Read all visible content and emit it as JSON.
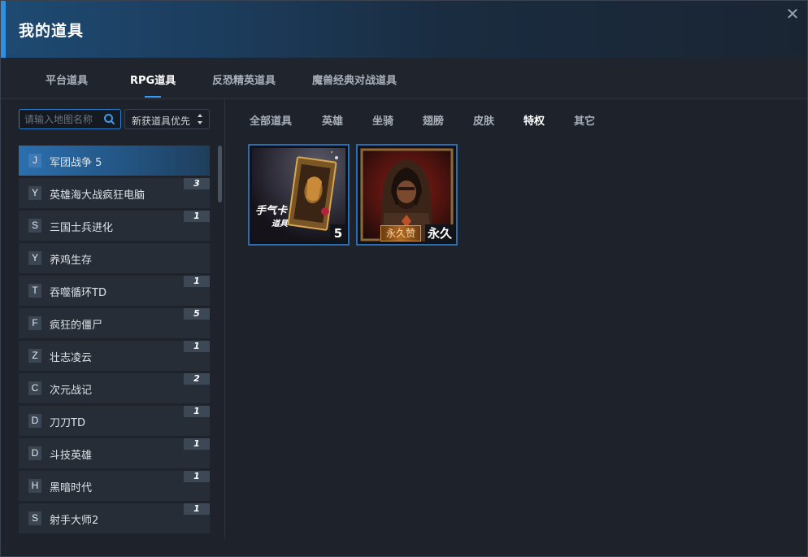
{
  "window": {
    "title": "我的道具",
    "close_glyph": "✕"
  },
  "main_tabs": [
    {
      "label": "平台道具",
      "active": false
    },
    {
      "label": "RPG道具",
      "active": true
    },
    {
      "label": "反恐精英道具",
      "active": false
    },
    {
      "label": "魔兽经典对战道具",
      "active": false
    }
  ],
  "search": {
    "placeholder": "请输入地图名称",
    "value": ""
  },
  "sort": {
    "selected": "新获道具优先"
  },
  "games": [
    {
      "letter": "J",
      "name": "军团战争 5",
      "count": "",
      "selected": true
    },
    {
      "letter": "Y",
      "name": "英雄海大战疯狂电脑",
      "count": "3",
      "selected": false
    },
    {
      "letter": "S",
      "name": "三国士兵进化",
      "count": "1",
      "selected": false
    },
    {
      "letter": "Y",
      "name": "养鸡生存",
      "count": "",
      "selected": false
    },
    {
      "letter": "T",
      "name": "吞噬循环TD",
      "count": "1",
      "selected": false
    },
    {
      "letter": "F",
      "name": "疯狂的僵尸",
      "count": "5",
      "selected": false
    },
    {
      "letter": "Z",
      "name": "壮志凌云",
      "count": "1",
      "selected": false
    },
    {
      "letter": "C",
      "name": "次元战记",
      "count": "2",
      "selected": false
    },
    {
      "letter": "D",
      "name": "刀刀TD",
      "count": "1",
      "selected": false
    },
    {
      "letter": "D",
      "name": "斗技英雄",
      "count": "1",
      "selected": false
    },
    {
      "letter": "H",
      "name": "黑暗时代",
      "count": "1",
      "selected": false
    },
    {
      "letter": "S",
      "name": "射手大师2",
      "count": "1",
      "selected": false
    }
  ],
  "sub_tabs": [
    {
      "label": "全部道具",
      "active": false
    },
    {
      "label": "英雄",
      "active": false
    },
    {
      "label": "坐骑",
      "active": false
    },
    {
      "label": "翅膀",
      "active": false
    },
    {
      "label": "皮肤",
      "active": false
    },
    {
      "label": "特权",
      "active": true
    },
    {
      "label": "其它",
      "active": false
    }
  ],
  "items": [
    {
      "art_text_1": "手气卡",
      "art_text_2": "道具",
      "count": "5",
      "icon": "lucky-card-icon"
    },
    {
      "ribbon": "永久赞",
      "count": "永久",
      "icon": "hooded-warrior-icon"
    }
  ],
  "colors": {
    "accent": "#2e9bff",
    "selected_item": "#2b6fae",
    "card_border": "#2a6db3"
  }
}
